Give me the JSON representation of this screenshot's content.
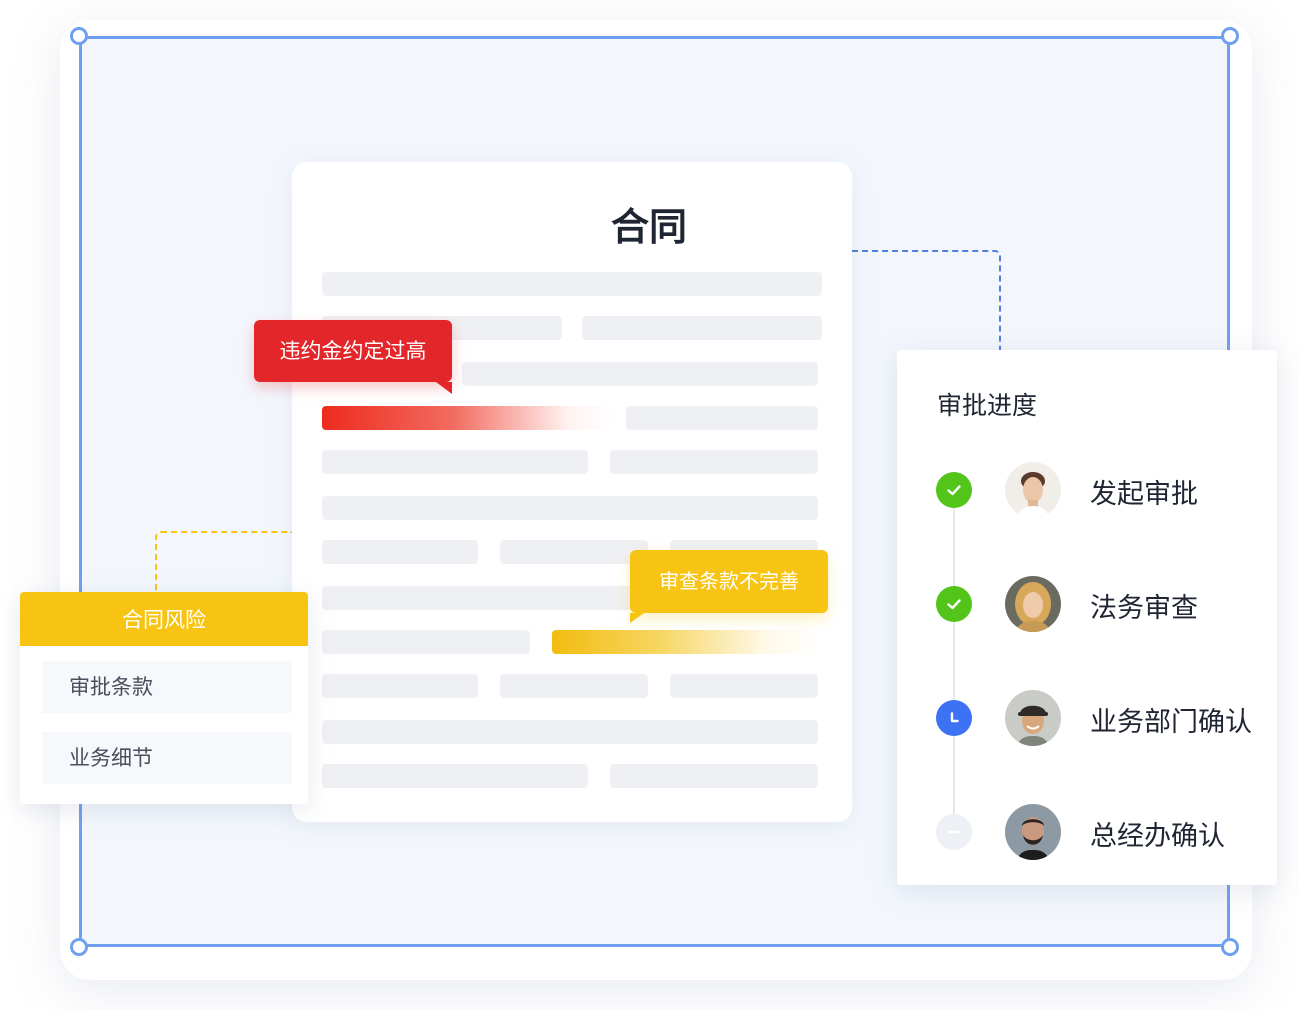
{
  "document": {
    "title": "合同",
    "risk_tag_penalty": "违约金约定过高",
    "risk_tag_terms": "审查条款不完善"
  },
  "risk_panel": {
    "title": "合同风险",
    "items": [
      {
        "label": "审批条款"
      },
      {
        "label": "业务细节"
      }
    ]
  },
  "approval": {
    "title": "审批进度",
    "steps": [
      {
        "label": "发起审批",
        "status": "done"
      },
      {
        "label": "法务审查",
        "status": "done"
      },
      {
        "label": "业务部门确认",
        "status": "current"
      },
      {
        "label": "总经办确认",
        "status": "pending"
      }
    ]
  },
  "colors": {
    "frame": "#6fa0f0",
    "danger": "#e3262a",
    "warning": "#f8c414",
    "success": "#52c41a",
    "current": "#3e72f5"
  }
}
